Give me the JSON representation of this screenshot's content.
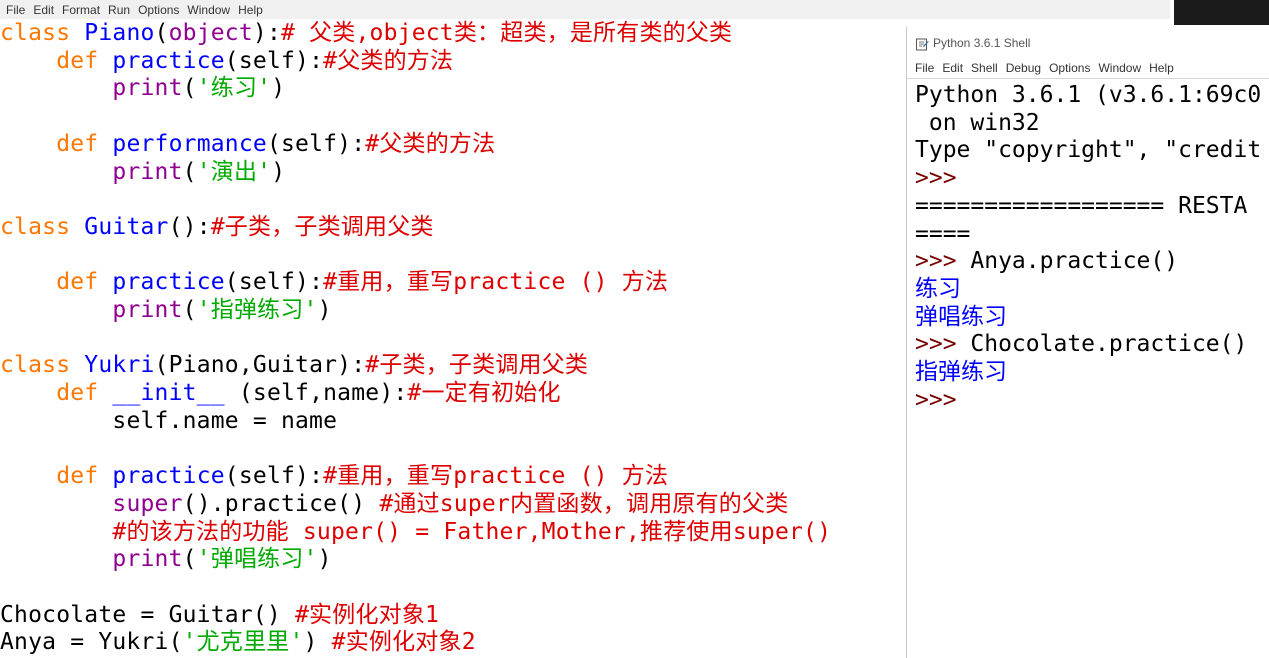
{
  "editor_menu": [
    "File",
    "Edit",
    "Format",
    "Run",
    "Options",
    "Window",
    "Help"
  ],
  "editor_lines": [
    [
      [
        "class ",
        "kw"
      ],
      [
        "Piano",
        "def"
      ],
      [
        "(",
        "blk"
      ],
      [
        "object",
        "bi"
      ],
      [
        "):",
        "blk"
      ],
      [
        "# 父类,object类：超类，是所有类的父类",
        "cmt"
      ]
    ],
    [
      [
        "    ",
        "blk"
      ],
      [
        "def ",
        "kw"
      ],
      [
        "practice",
        "def"
      ],
      [
        "(self):",
        "blk"
      ],
      [
        "#父类的方法",
        "cmt"
      ]
    ],
    [
      [
        "        ",
        "blk"
      ],
      [
        "print",
        "bi"
      ],
      [
        "(",
        "blk"
      ],
      [
        "'练习'",
        "str"
      ],
      [
        ")",
        "blk"
      ]
    ],
    [],
    [
      [
        "    ",
        "blk"
      ],
      [
        "def ",
        "kw"
      ],
      [
        "performance",
        "def"
      ],
      [
        "(self):",
        "blk"
      ],
      [
        "#父类的方法",
        "cmt"
      ]
    ],
    [
      [
        "        ",
        "blk"
      ],
      [
        "print",
        "bi"
      ],
      [
        "(",
        "blk"
      ],
      [
        "'演出'",
        "str"
      ],
      [
        ")",
        "blk"
      ]
    ],
    [],
    [
      [
        "class ",
        "kw"
      ],
      [
        "Guitar",
        "def"
      ],
      [
        "():",
        "blk"
      ],
      [
        "#子类，子类调用父类",
        "cmt"
      ]
    ],
    [],
    [
      [
        "    ",
        "blk"
      ],
      [
        "def ",
        "kw"
      ],
      [
        "practice",
        "def"
      ],
      [
        "(self):",
        "blk"
      ],
      [
        "#重用，重写practice () 方法",
        "cmt"
      ]
    ],
    [
      [
        "        ",
        "blk"
      ],
      [
        "print",
        "bi"
      ],
      [
        "(",
        "blk"
      ],
      [
        "'指弹练习'",
        "str"
      ],
      [
        ")",
        "blk"
      ]
    ],
    [],
    [
      [
        "class ",
        "kw"
      ],
      [
        "Yukri",
        "def"
      ],
      [
        "(Piano,Guitar):",
        "blk"
      ],
      [
        "#子类，子类调用父类",
        "cmt"
      ]
    ],
    [
      [
        "    ",
        "blk"
      ],
      [
        "def ",
        "kw"
      ],
      [
        "__init__",
        "def"
      ],
      [
        " (self,name):",
        "blk"
      ],
      [
        "#一定有初始化",
        "cmt"
      ]
    ],
    [
      [
        "        ",
        "blk"
      ],
      [
        "self.name = name",
        "blk"
      ]
    ],
    [],
    [
      [
        "    ",
        "blk"
      ],
      [
        "def ",
        "kw"
      ],
      [
        "practice",
        "def"
      ],
      [
        "(self):",
        "blk"
      ],
      [
        "#重用，重写practice () 方法",
        "cmt"
      ]
    ],
    [
      [
        "        ",
        "blk"
      ],
      [
        "super",
        "bi"
      ],
      [
        "().practice() ",
        "blk"
      ],
      [
        "#通过super内置函数，调用原有的父类",
        "cmt"
      ]
    ],
    [
      [
        "        ",
        "blk"
      ],
      [
        "#的该方法的功能 super() = Father,Mother,推荐使用super()",
        "cmt"
      ]
    ],
    [
      [
        "        ",
        "blk"
      ],
      [
        "print",
        "bi"
      ],
      [
        "(",
        "blk"
      ],
      [
        "'弹唱练习'",
        "str"
      ],
      [
        ")",
        "blk"
      ]
    ],
    [],
    [
      [
        "Chocolate = Guitar() ",
        "blk"
      ],
      [
        "#实例化对象1",
        "cmt"
      ]
    ],
    [
      [
        "Anya = Yukri(",
        "blk"
      ],
      [
        "'尤克里里'",
        "str"
      ],
      [
        ") ",
        "blk"
      ],
      [
        "#实例化对象2",
        "cmt"
      ]
    ]
  ],
  "shell": {
    "title": "Python 3.6.1 Shell",
    "menu": [
      "File",
      "Edit",
      "Shell",
      "Debug",
      "Options",
      "Window",
      "Help"
    ],
    "lines": [
      [
        [
          "Python 3.6.1 (v3.6.1:69c0",
          "blk"
        ]
      ],
      [
        [
          " on win32",
          "blk"
        ]
      ],
      [
        [
          "Type \"copyright\", \"credit",
          "blk"
        ]
      ],
      [
        [
          ">>>",
          "prompt"
        ]
      ],
      [
        [
          "================== RESTA",
          "blk"
        ]
      ],
      [
        [
          "====",
          "blk"
        ]
      ],
      [
        [
          ">>> ",
          "prompt"
        ],
        [
          "Anya.practice()",
          "blk"
        ]
      ],
      [
        [
          "练习",
          "out"
        ]
      ],
      [
        [
          "弹唱练习",
          "out"
        ]
      ],
      [
        [
          ">>> ",
          "prompt"
        ],
        [
          "Chocolate.practice()",
          "blk"
        ]
      ],
      [
        [
          "指弹练习",
          "out"
        ]
      ],
      [
        [
          ">>>",
          "prompt"
        ]
      ]
    ]
  },
  "colors": {
    "keyword": "#ff7700",
    "defname": "#0000ff",
    "string": "#00aa00",
    "comment": "#dd0000",
    "builtin": "#900090",
    "prompt": "#770000",
    "output": "#0000ff"
  }
}
